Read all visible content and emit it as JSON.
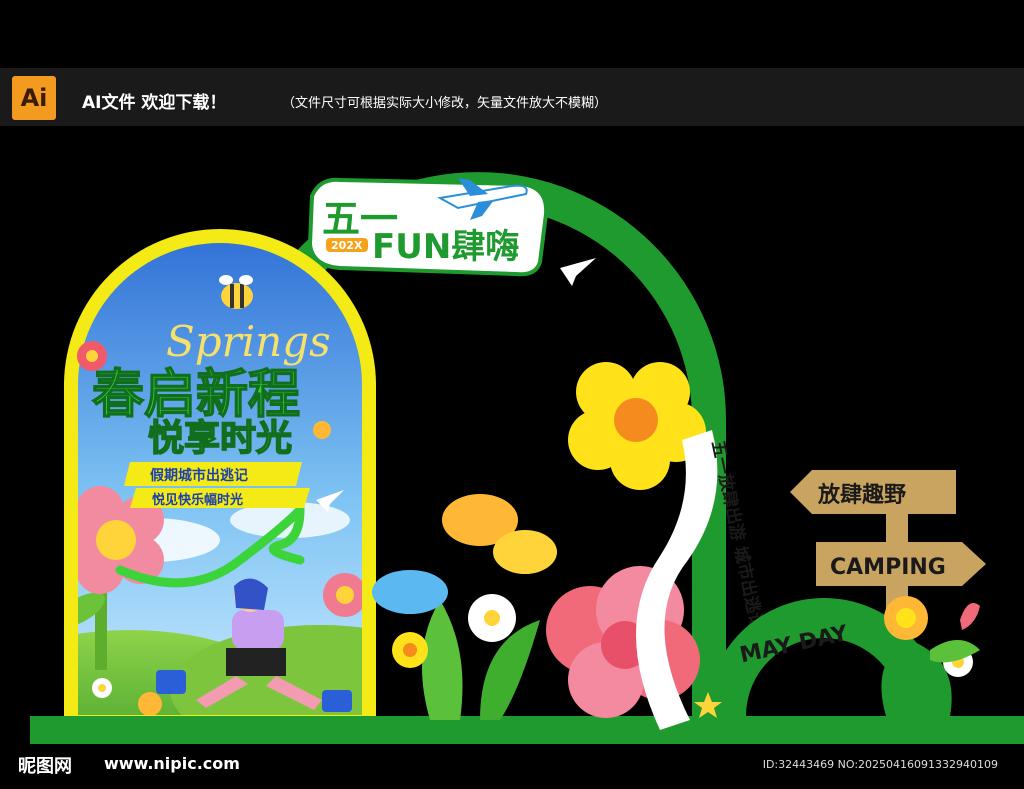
{
  "topbar": {
    "logo": "Ai",
    "title": "AI文件 欢迎下载！",
    "note": "（文件尺寸可根据实际大小修改，矢量文件放大不模糊）"
  },
  "arch": {
    "title_top": "五一",
    "title_main": "FUN肆嗨",
    "year": "202X",
    "ribbon": "五一放肆出游 城市出逃记"
  },
  "poster": {
    "script": "Springs",
    "line1": "春启新程",
    "line2": "悦享时光",
    "banner1": "假期城市出逃记",
    "banner2": "悦见快乐幅时光"
  },
  "signpost": {
    "sign1": "放肆趣野",
    "sign2": "CAMPING",
    "arc_text": "MAY DAY"
  },
  "footer": {
    "site_logo": "昵图网",
    "site_url": "www.nipic.com",
    "image_id": "ID:32443469 NO:20250416091332940109"
  },
  "colors": {
    "arch_green": "#1f9a2e",
    "poster_yellow": "#f4ea16",
    "sky_blue": "#3d8fe0",
    "flower_yellow": "#ffe21a",
    "flower_pink": "#f06a7a",
    "sign_brown": "#c9a460"
  }
}
